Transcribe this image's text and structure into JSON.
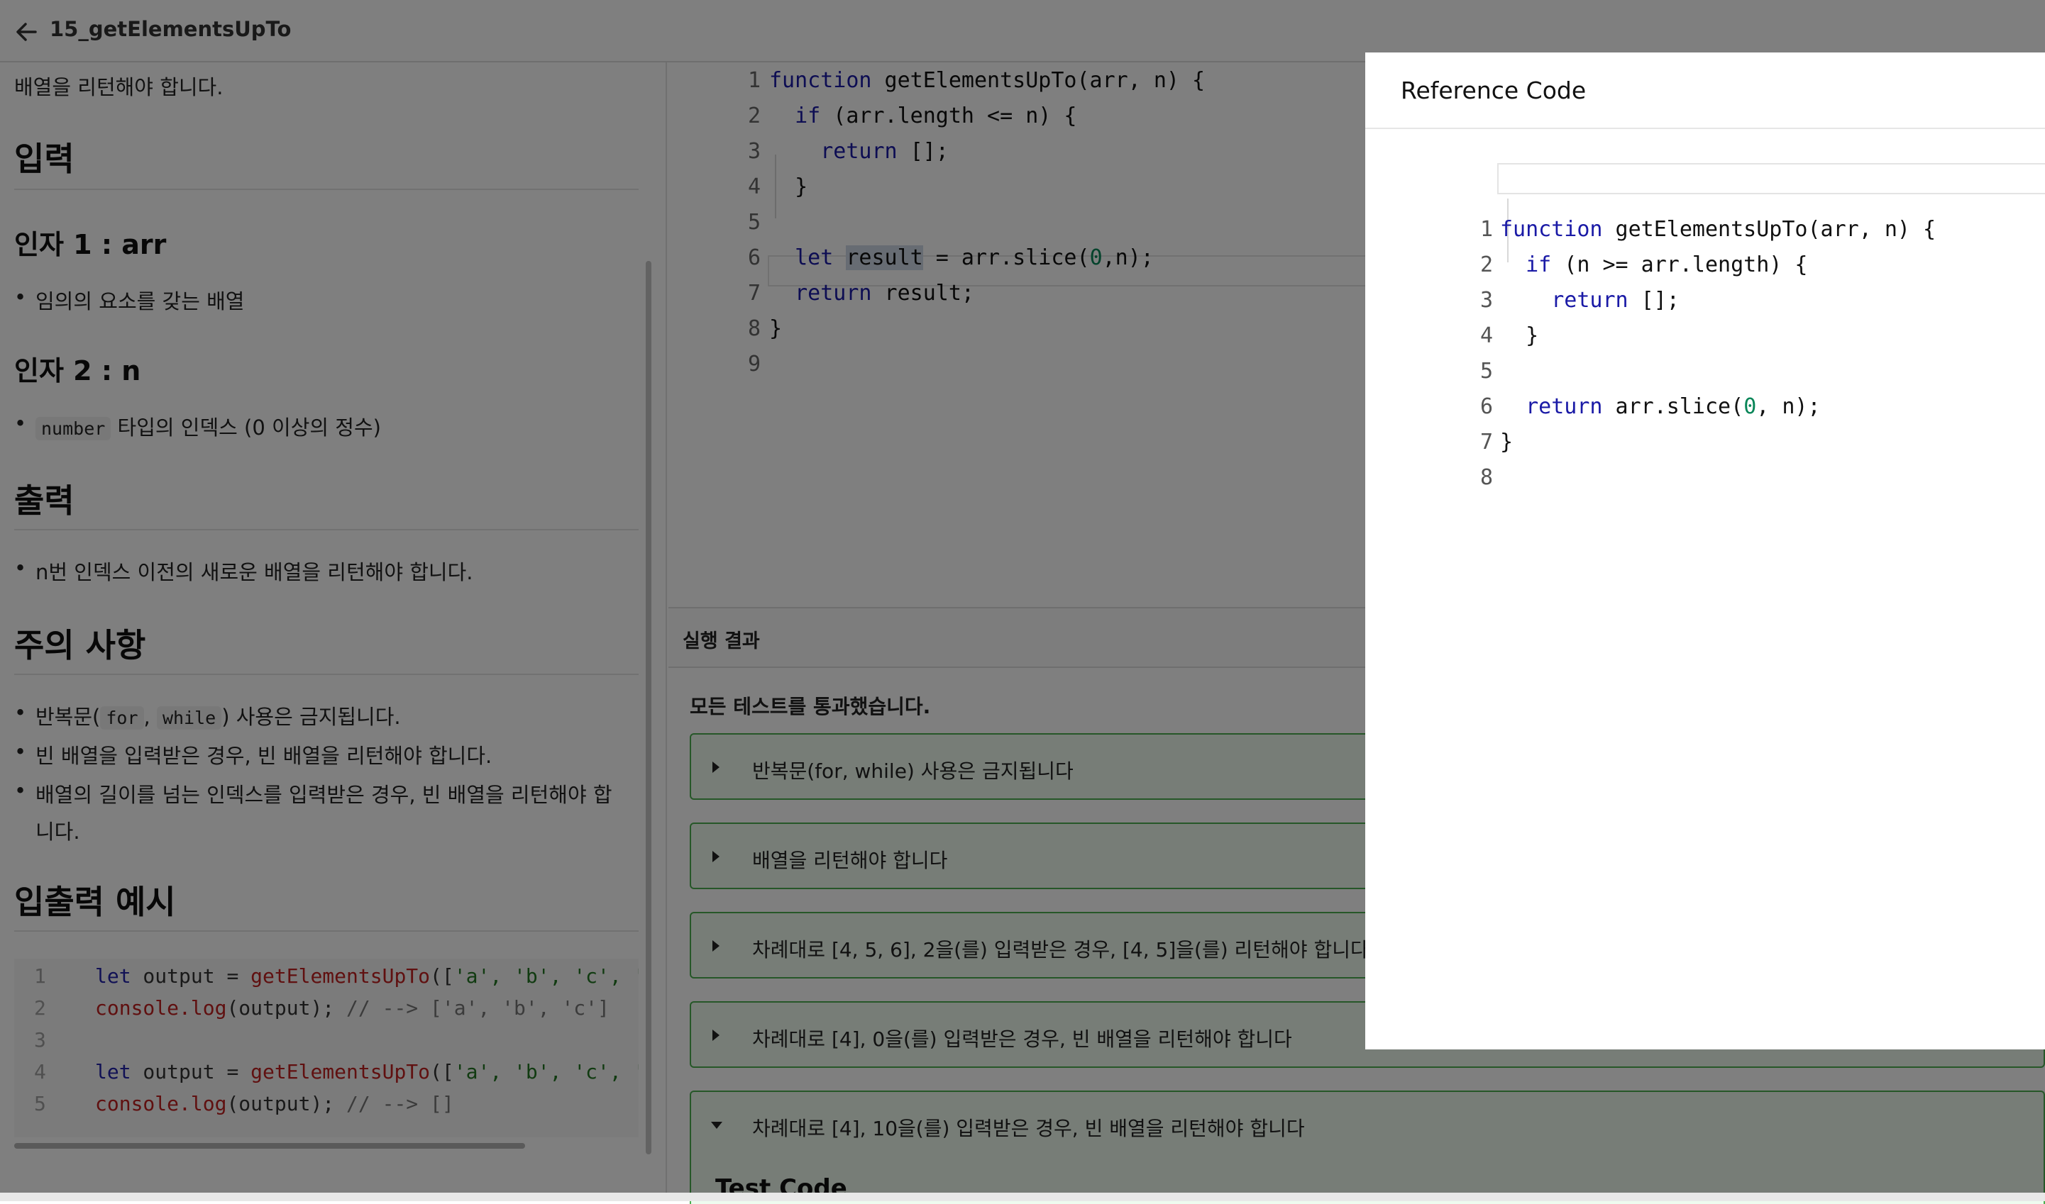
{
  "header": {
    "title": "15_getElementsUpTo"
  },
  "problem": {
    "intro": "배열을 리턴해야 합니다.",
    "input_heading": "입력",
    "arg1_heading": "인자 1 : arr",
    "arg1_desc": "임의의 요소를 갖는 배열",
    "arg2_heading": "인자 2 : n",
    "arg2_chip": "number",
    "arg2_desc": "타입의 인덱스 (0 이상의 정수)",
    "output_heading": "출력",
    "output_desc": "n번 인덱스 이전의 새로운 배열을 리턴해야 합니다.",
    "notes_heading": "주의 사항",
    "note1_pre": "반복문(",
    "note1_chip1": "for",
    "note1_sep": ",",
    "note1_chip2": "while",
    "note1_post": ") 사용은 금지됩니다.",
    "note2": "빈 배열을 입력받은 경우, 빈 배열을 리턴해야 합니다.",
    "note3_line1": "배열의 길이를 넘는 인덱스를 입력받은 경우, 빈 배열을 리턴해야 합",
    "note3_line2": "니다.",
    "examples_heading": "입출력 예시",
    "example_lines": [
      {
        "num": "1",
        "kw": "let",
        "var": " output = ",
        "fn": "getElementsUpTo",
        "rest": "([",
        "str": "'a', 'b', 'c', 'd'",
        "cm": ""
      },
      {
        "num": "2",
        "kw": "",
        "var": "",
        "fn": "console.log",
        "rest": "(output); ",
        "str": "",
        "cm": "// --> ['a', 'b', 'c']"
      },
      {
        "num": "3",
        "kw": "",
        "var": "",
        "fn": "",
        "rest": "",
        "str": "",
        "cm": ""
      },
      {
        "num": "4",
        "kw": "let",
        "var": " output = ",
        "fn": "getElementsUpTo",
        "rest": "([",
        "str": "'a', 'b', 'c', 'd'",
        "cm": ""
      },
      {
        "num": "5",
        "kw": "",
        "var": "",
        "fn": "console.log",
        "rest": "(output); ",
        "str": "",
        "cm": "// --> []"
      }
    ]
  },
  "editor": {
    "lines": [
      {
        "num": "1",
        "indent": "",
        "kw": "function",
        "text": " getElementsUpTo(arr, n) {"
      },
      {
        "num": "2",
        "indent": "  ",
        "kw": "if",
        "text": " (arr.length <= n) {"
      },
      {
        "num": "3",
        "indent": "    ",
        "kw": "return",
        "text": " [];"
      },
      {
        "num": "4",
        "indent": "  ",
        "kw": "",
        "text": "}"
      },
      {
        "num": "5",
        "indent": "",
        "kw": "",
        "text": ""
      },
      {
        "num": "6",
        "indent": "  ",
        "kw": "let",
        "hl": "result",
        "text": " = arr.slice(",
        "n0": "0",
        "tail": ",n);"
      },
      {
        "num": "7",
        "indent": "  ",
        "kw": "return",
        "text": " result;"
      },
      {
        "num": "8",
        "indent": "",
        "kw": "",
        "text": "}"
      },
      {
        "num": "9",
        "indent": "",
        "kw": "",
        "text": ""
      }
    ]
  },
  "results": {
    "heading": "실행 결과",
    "summary": "모든 테스트를 통과했습니다.",
    "cases": [
      "반복문(for, while) 사용은 금지됩니다",
      "배열을 리턴해야 합니다",
      "차례대로 [4, 5, 6], 2을(를) 입력받은 경우, [4, 5]을(를) 리턴해야 합니다",
      "차례대로 [4], 0을(를) 입력받은 경우, 빈 배열을 리턴해야 합니다",
      "차례대로 [4], 10을(를) 입력받은 경우, 빈 배열을 리턴해야 합니다"
    ],
    "test_code_label": "Test Code"
  },
  "modal": {
    "title": "Reference Code",
    "lines": [
      {
        "num": "1",
        "indent": "",
        "kw": "function",
        "text": " getElementsUpTo(arr, n) {"
      },
      {
        "num": "2",
        "indent": "  ",
        "kw": "if",
        "text": " (n >= arr.length) {"
      },
      {
        "num": "3",
        "indent": "    ",
        "kw": "return",
        "text": " [];"
      },
      {
        "num": "4",
        "indent": "  ",
        "kw": "",
        "text": "}"
      },
      {
        "num": "5",
        "indent": "",
        "kw": "",
        "text": ""
      },
      {
        "num": "6",
        "indent": "  ",
        "kw": "return",
        "text": " arr.slice(",
        "n0": "0",
        "tail": ", n);"
      },
      {
        "num": "7",
        "indent": "",
        "kw": "",
        "text": "}"
      },
      {
        "num": "8",
        "indent": "",
        "kw": "",
        "text": ""
      }
    ]
  }
}
